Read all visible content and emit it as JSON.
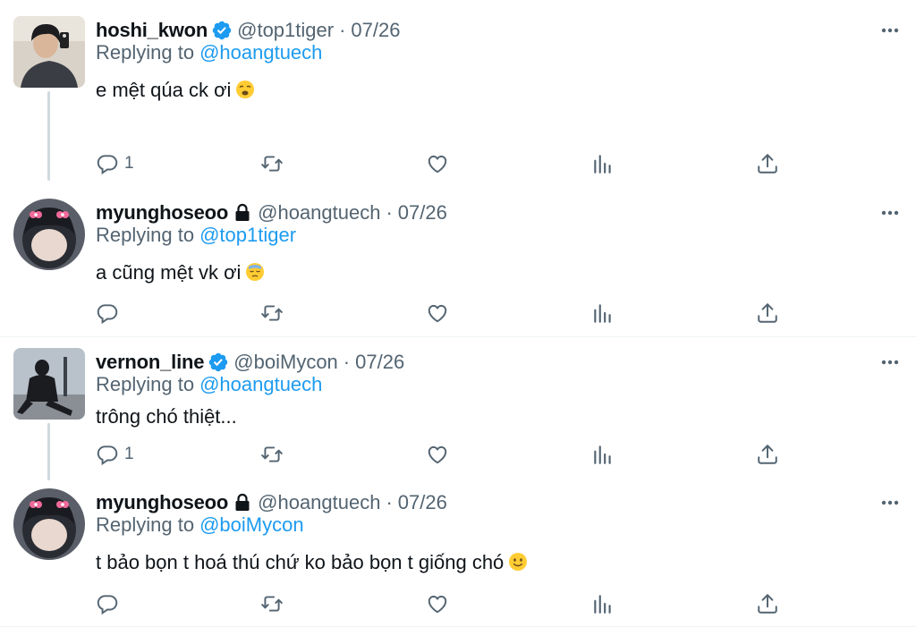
{
  "tweets": [
    {
      "name": "hoshi_kwon",
      "verified": true,
      "handle": "@top1tiger",
      "dot": "·",
      "date": "07/26",
      "replying_prefix": "Replying to",
      "replying_to": "@hoangtuech",
      "text": "e mệt qúa ck ơi",
      "emoji_icon": "weary-face-emoji",
      "reply_count": "1",
      "more_icon": "more-icon"
    },
    {
      "name": "myunghoseoo",
      "locked": true,
      "handle": "@hoangtuech",
      "dot": "·",
      "date": "07/26",
      "replying_prefix": "Replying to",
      "replying_to": "@top1tiger",
      "text": "a cũng mệt vk ơi",
      "emoji_icon": "sleepy-face-emoji",
      "reply_count": "",
      "more_icon": "more-icon"
    },
    {
      "name": "vernon_line",
      "verified": true,
      "handle": "@boiMycon",
      "dot": "·",
      "date": "07/26",
      "replying_prefix": "Replying to",
      "replying_to": "@hoangtuech",
      "text": "trông chó thiệt...",
      "emoji_icon": "",
      "reply_count": "1",
      "more_icon": "more-icon"
    },
    {
      "name": "myunghoseoo",
      "locked": true,
      "handle": "@hoangtuech",
      "dot": "·",
      "date": "07/26",
      "replying_prefix": "Replying to",
      "replying_to": "@boiMycon",
      "text": "t bảo bọn t hoá thú chứ ko bảo bọn t giống chó",
      "emoji_icon": "slightly-smiling-face-emoji",
      "reply_count": "",
      "more_icon": "more-icon"
    }
  ],
  "icons": {
    "reply": "reply-icon",
    "retweet": "retweet-icon",
    "like": "like-icon",
    "views": "views-icon",
    "share": "share-icon",
    "verified": "verified-badge-icon",
    "lock": "lock-icon"
  },
  "colors": {
    "accent": "#1d9bf0",
    "secondary_text": "#536471",
    "thread_line": "#cfd9de"
  }
}
